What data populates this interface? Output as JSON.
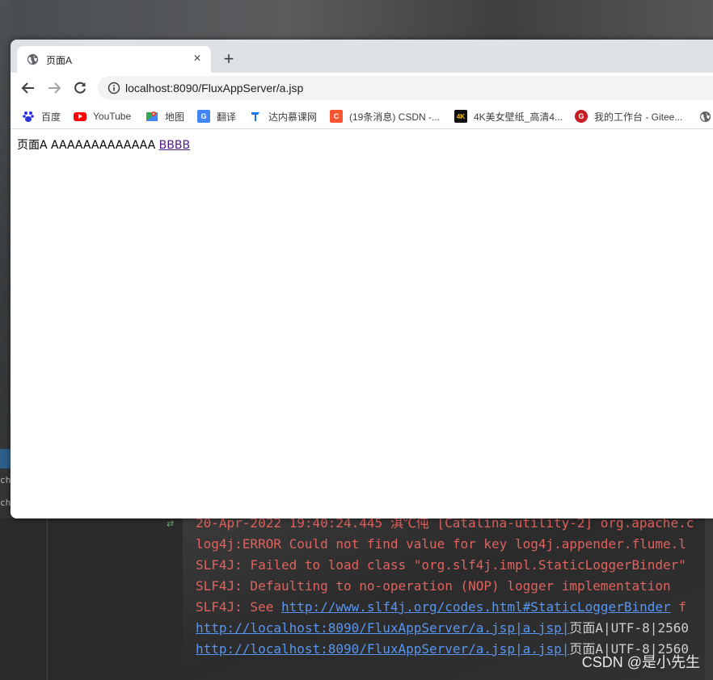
{
  "browser": {
    "tab": {
      "title": "页面A",
      "close_glyph": "×"
    },
    "new_tab_glyph": "+",
    "url": "localhost:8090/FluxAppServer/a.jsp",
    "bookmarks": [
      {
        "label": "百度",
        "icon": "baidu-icon"
      },
      {
        "label": "YouTube",
        "icon": "youtube-icon"
      },
      {
        "label": "地图",
        "icon": "maps-icon"
      },
      {
        "label": "翻译",
        "icon": "translate-icon"
      },
      {
        "label": "达内慕课网",
        "icon": "tarena-icon"
      },
      {
        "label": "(19条消息) CSDN -...",
        "icon": "csdn-icon"
      },
      {
        "label": "4K美女壁纸_高清4...",
        "icon": "4k-icon"
      },
      {
        "label": "我的工作台 - Gitee...",
        "icon": "gitee-icon"
      }
    ],
    "page": {
      "text": "页面A AAAAAAAAAAAAA",
      "link": "BBBB"
    }
  },
  "console": {
    "lines": [
      {
        "text": "20-Apr-2022 19:40:24.445 淇℃伅 [Catalina-utility-2] org.apache.c"
      },
      {
        "text": "log4j:ERROR Could not find value for key log4j.appender.flume.l"
      },
      {
        "text": "SLF4J: Failed to load class \"org.slf4j.impl.StaticLoggerBinder\""
      },
      {
        "text": "SLF4J: Defaulting to no-operation (NOP) logger implementation"
      },
      {
        "prefix": "SLF4J: See ",
        "link": "http://www.slf4j.org/codes.html#StaticLoggerBinder",
        "suffix": " f"
      },
      {
        "link": "http://localhost:8090/FluxAppServer/a.jsp|a.jsp|",
        "suffix": "页面A|UTF-8|2560"
      },
      {
        "link": "http://localhost:8090/FluxAppServer/a.jsp|a.jsp|",
        "suffix": "页面A|UTF-8|2560"
      }
    ]
  },
  "background": {
    "left_text_1": "chr",
    "left_text_2": "chr"
  },
  "watermark": "CSDN @是小先生"
}
